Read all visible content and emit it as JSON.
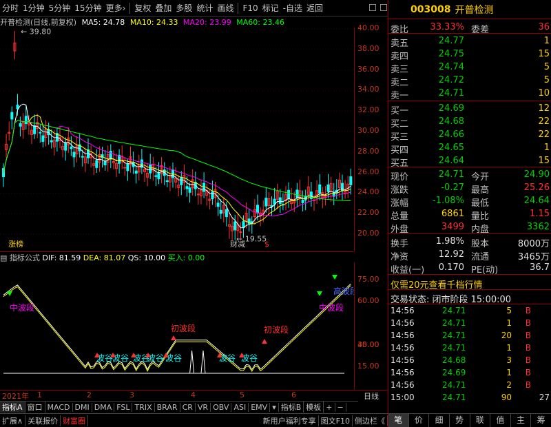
{
  "toolbar": {
    "items": [
      "分时",
      "1分钟",
      "5分钟",
      "15分钟",
      "更多›",
      "复权",
      "叠加",
      "多股",
      "统计",
      "画线",
      "F10",
      "标记",
      "-自选",
      "返回"
    ]
  },
  "chart": {
    "name": "开普检测(日线,前复权)",
    "ma5": "MA5: 24.78",
    "ma10": "MA10: 24.33",
    "ma20": "MA20: 23.99",
    "ma60": "MA60: 23.46",
    "high_label": "39.80",
    "low_label": "19.55",
    "yticks": [
      "40.00",
      "38.00",
      "36.00",
      "34.00",
      "32.00",
      "30.00",
      "28.00",
      "26.00",
      "24.00",
      "22.00",
      "20.00"
    ],
    "marker_left": "涨榜",
    "marker_mid": "财减",
    "marker_s": "$",
    "colors": {
      "ma5": "#ffffff",
      "ma10": "#ffff00",
      "ma20": "#ff00ff",
      "ma60": "#00ff00",
      "up": "#ff3030",
      "down": "#00ffff"
    }
  },
  "indicator": {
    "name": "指标公式",
    "dif": "DIF: 81.59",
    "dea": "DEA: 81.07",
    "qs": "QS: 10.00",
    "buy": "买入: 0.00",
    "yticks": [
      "75.00",
      "60.00",
      "45.00",
      "30.00",
      "15.00"
    ],
    "labels": {
      "mid1": "中波段",
      "init1": "初波段",
      "init2": "初波段",
      "mid2": "中波段",
      "high": "高波段",
      "valley": "波谷"
    }
  },
  "time_axis": {
    "year": "2021年",
    "months": [
      "1",
      "2",
      "3",
      "4",
      "5",
      "6"
    ],
    "period": "日线"
  },
  "tabs_a": [
    "指标A",
    "窗口",
    "MACD",
    "DMI",
    "DMA",
    "FSL",
    "TRIX",
    "BRAR",
    "CR",
    "VR",
    "OBV",
    "ASI",
    "EMV",
    "▾",
    "指标B",
    "模板",
    "+",
    "−"
  ],
  "tabs_b": [
    "扩展∧",
    "关联报价",
    "财富圈",
    "新用户福利专享",
    "图文F10",
    "侧边栏《"
  ],
  "quote": {
    "code": "003008",
    "name": "开普检测",
    "weibi_label": "委比",
    "weibi": "33.33%",
    "weicha_label": "委差",
    "weicha": "36",
    "asks": [
      {
        "l": "卖五",
        "p": "24.77",
        "v": "1"
      },
      {
        "l": "卖四",
        "p": "24.75",
        "v": "15"
      },
      {
        "l": "卖三",
        "p": "24.74",
        "v": "5"
      },
      {
        "l": "卖二",
        "p": "24.72",
        "v": "5"
      },
      {
        "l": "卖一",
        "p": "24.71",
        "v": "10"
      }
    ],
    "bids": [
      {
        "l": "买一",
        "p": "24.69",
        "v": "12"
      },
      {
        "l": "买二",
        "p": "24.68",
        "v": "22"
      },
      {
        "l": "买三",
        "p": "24.66",
        "v": "22"
      },
      {
        "l": "买四",
        "p": "24.65",
        "v": "1"
      },
      {
        "l": "买五",
        "p": "24.64",
        "v": "15"
      }
    ],
    "stats": [
      {
        "l1": "现价",
        "v1": "24.71",
        "c1": "green",
        "l2": "今开",
        "v2": "24.90",
        "c2": "green"
      },
      {
        "l1": "涨跌",
        "v1": "-0.27",
        "c1": "green",
        "l2": "最高",
        "v2": "25.26",
        "c2": "red"
      },
      {
        "l1": "涨幅",
        "v1": "-1.08%",
        "c1": "green",
        "l2": "最低",
        "v2": "24.64",
        "c2": "green"
      },
      {
        "l1": "总量",
        "v1": "6861",
        "c1": "yellow",
        "l2": "量比",
        "v2": "1.15",
        "c2": "red"
      },
      {
        "l1": "外盘",
        "v1": "3499",
        "c1": "red",
        "l2": "内盘",
        "v2": "3362",
        "c2": "green"
      }
    ],
    "stats2": [
      {
        "l1": "换手",
        "v1": "1.98%",
        "l2": "股本",
        "v2": "8000万"
      },
      {
        "l1": "净资",
        "v1": "12.92",
        "l2": "流通",
        "v2": "3465万"
      },
      {
        "l1": "收益(一)",
        "v1": "0.170",
        "l2": "PE(动)",
        "v2": "36.7"
      }
    ],
    "promo": "仅需20元查看千档行情",
    "trade_state": "交易状态: 闭市阶段 15:00:00",
    "ticks": [
      {
        "t": "14:56",
        "p": "24.71",
        "v": "5",
        "d": "B"
      },
      {
        "t": "14:56",
        "p": "24.71",
        "v": "1",
        "d": "B"
      },
      {
        "t": "14:56",
        "p": "24.71",
        "v": "20",
        "d": "B"
      },
      {
        "t": "14:56",
        "p": "24.71",
        "v": "1",
        "d": "B"
      },
      {
        "t": "14:56",
        "p": "24.68",
        "v": "3",
        "d": "B"
      },
      {
        "t": "14:56",
        "p": "24.69",
        "v": "1",
        "d": "B"
      },
      {
        "t": "14:56",
        "p": "24.71",
        "v": "2",
        "d": "B"
      },
      {
        "t": "15:00",
        "p": "24.71",
        "v": "90",
        "d": "27"
      }
    ],
    "bottom_tabs": [
      "笔",
      "价",
      "细",
      "势",
      "联",
      "值",
      "主",
      "筹"
    ]
  }
}
